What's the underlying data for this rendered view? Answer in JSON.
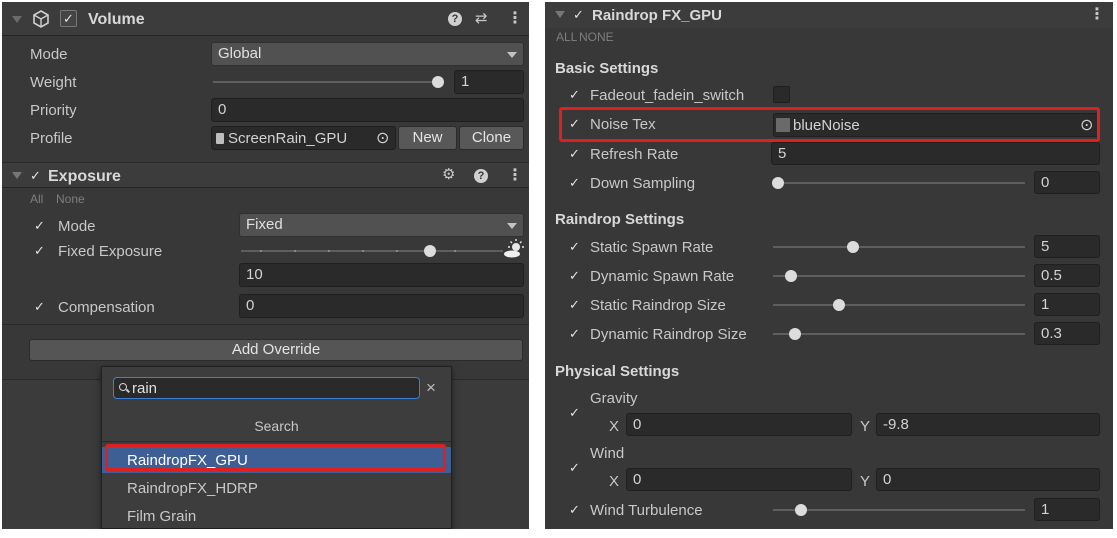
{
  "volume": {
    "title": "Volume",
    "mode_label": "Mode",
    "mode_value": "Global",
    "weight_label": "Weight",
    "weight_value": "1",
    "weight_fraction": 1.0,
    "priority_label": "Priority",
    "priority_value": "0",
    "profile_label": "Profile",
    "profile_value": "ScreenRain_GPU",
    "new_label": "New",
    "clone_label": "Clone"
  },
  "exposure": {
    "title": "Exposure",
    "all_label": "All",
    "none_label": "None",
    "mode_label": "Mode",
    "mode_value": "Fixed",
    "fixed_label": "Fixed Exposure",
    "fixed_value": "10",
    "comp_label": "Compensation",
    "comp_value": "0"
  },
  "add_override_label": "Add Override",
  "search_popup": {
    "query": "rain",
    "header": "Search",
    "results": [
      "RaindropFX_GPU",
      "RaindropFX_HDRP",
      "Film Grain"
    ]
  },
  "raindrop": {
    "title": "Raindrop FX_GPU",
    "all_label": "ALL",
    "none_label": "NONE",
    "basic_heading": "Basic Settings",
    "fadeout_label": "Fadeout_fadein_switch",
    "noise_label": "Noise Tex",
    "noise_value": "blueNoise",
    "refresh_label": "Refresh Rate",
    "refresh_value": "5",
    "down_label": "Down Sampling",
    "down_value": "0",
    "raindrop_heading": "Raindrop Settings",
    "static_spawn_label": "Static Spawn Rate",
    "static_spawn_value": "5",
    "dynamic_spawn_label": "Dynamic Spawn Rate",
    "dynamic_spawn_value": "0.5",
    "static_size_label": "Static Raindrop Size",
    "static_size_value": "1",
    "dynamic_size_label": "Dynamic Raindrop Size",
    "dynamic_size_value": "0.3",
    "physical_heading": "Physical Settings",
    "gravity_label": "Gravity",
    "gravity_x": "0",
    "gravity_y": "-9.8",
    "wind_label": "Wind",
    "wind_x": "0",
    "wind_y": "0",
    "x_label": "X",
    "y_label": "Y",
    "turbulence_label": "Wind Turbulence",
    "turbulence_value": "1"
  },
  "icons": {
    "check": "✓",
    "help": "?",
    "kebab": "⋮",
    "search": "⚲",
    "close": "×",
    "target": "⊙",
    "gear_plus": "⚙",
    "sliders": "⇄"
  },
  "colors": {
    "highlight_red": "#e0201e",
    "selected_row": "#3e5f96",
    "focus_blue": "#3b7fd6"
  }
}
